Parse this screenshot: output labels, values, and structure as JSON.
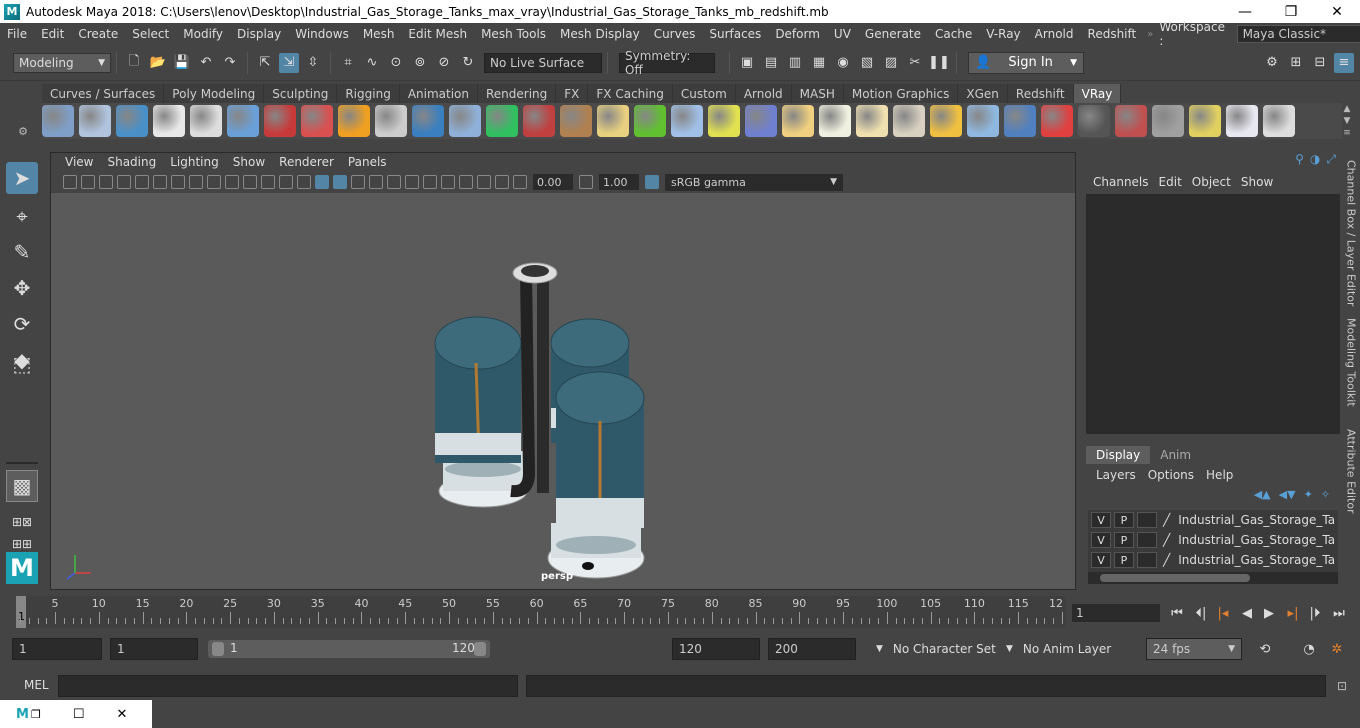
{
  "window": {
    "app_icon": "M",
    "title": "Autodesk Maya 2018: C:\\Users\\lenov\\Desktop\\Industrial_Gas_Storage_Tanks_max_vray\\Industrial_Gas_Storage_Tanks_mb_redshift.mb",
    "minimize": "—",
    "maximize": "❐",
    "close": "✕"
  },
  "menus": [
    "File",
    "Edit",
    "Create",
    "Select",
    "Modify",
    "Display",
    "Windows",
    "Mesh",
    "Edit Mesh",
    "Mesh Tools",
    "Mesh Display",
    "Curves",
    "Surfaces",
    "Deform",
    "UV",
    "Generate",
    "Cache",
    "V-Ray",
    "Arnold",
    "Redshift"
  ],
  "workspace": {
    "label": "Workspace :",
    "value": "Maya Classic*"
  },
  "status_line": {
    "menu_set": "Modeling",
    "live_surface": "No Live Surface",
    "symmetry": "Symmetry: Off",
    "sign_in": "Sign In"
  },
  "shelf": {
    "tabs": [
      "Curves / Surfaces",
      "Poly Modeling",
      "Sculpting",
      "Rigging",
      "Animation",
      "Rendering",
      "FX",
      "FX Caching",
      "Custom",
      "Arnold",
      "MASH",
      "Motion Graphics",
      "XGen",
      "Redshift",
      "VRay"
    ],
    "active_tab": "VRay",
    "icon_colors": [
      "#7f9fc8",
      "#b0c4de",
      "#4a90c8",
      "#e8e8e8",
      "#dddddd",
      "#6aa0d8",
      "#c83a3a",
      "#d85050",
      "#f0a020",
      "#cccccc",
      "#3a7fc0",
      "#8fb0d8",
      "#30c060",
      "#c04040",
      "#b08050",
      "#e8d080",
      "#60c030",
      "#a0c0e8",
      "#e0e050",
      "#7080d0",
      "#f0d080",
      "#f0f0e0",
      "#f0e0b0",
      "#d8d0c0",
      "#f0c040",
      "#8fb8e0",
      "#5080c0",
      "#e04040",
      "#555555",
      "#c05050",
      "#a0a0a0",
      "#e0d060",
      "#e8e8f0",
      "#dddddd"
    ]
  },
  "viewport": {
    "menus": [
      "View",
      "Shading",
      "Lighting",
      "Show",
      "Renderer",
      "Panels"
    ],
    "exposure": "0.00",
    "gamma": "1.00",
    "color_space": "sRGB gamma",
    "camera": "persp"
  },
  "channel_box": {
    "menus": [
      "Channels",
      "Edit",
      "Object",
      "Show"
    ]
  },
  "layer_editor": {
    "tabs": [
      "Display",
      "Anim"
    ],
    "menus": [
      "Layers",
      "Options",
      "Help"
    ],
    "layers": [
      {
        "v": "V",
        "p": "P",
        "name": "Industrial_Gas_Storage_Tanks_"
      },
      {
        "v": "V",
        "p": "P",
        "name": "Industrial_Gas_Storage_Tanks_"
      },
      {
        "v": "V",
        "p": "P",
        "name": "Industrial_Gas_Storage_Tanks_"
      }
    ]
  },
  "side_tabs": [
    "Channel Box / Layer Editor",
    "Modeling Toolkit",
    "Attribute Editor"
  ],
  "time_slider": {
    "labels": [
      "5",
      "10",
      "15",
      "20",
      "25",
      "30",
      "35",
      "40",
      "45",
      "50",
      "55",
      "60",
      "65",
      "70",
      "75",
      "80",
      "85",
      "90",
      "95",
      "100",
      "105",
      "110",
      "115",
      "12"
    ],
    "current_frame_marker": "1",
    "current_frame": "1"
  },
  "range_slider": {
    "start_time": "1",
    "playback_start": "1",
    "range_start": "1",
    "range_end": "120",
    "playback_end": "120",
    "end_time": "200",
    "character_set": "No Character Set",
    "anim_layer": "No Anim Layer",
    "fps": "24 fps"
  },
  "command_line": {
    "label": "MEL"
  }
}
